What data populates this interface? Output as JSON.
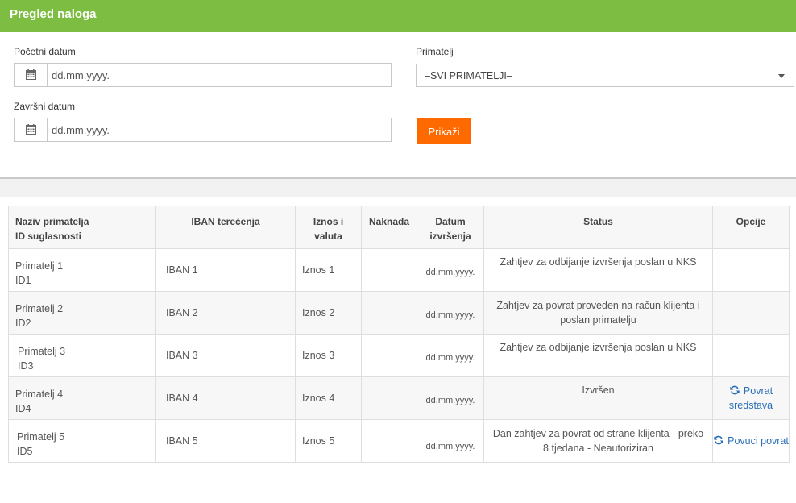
{
  "header": {
    "title": "Pregled naloga"
  },
  "filters": {
    "start_date_label": "Početni datum",
    "start_date_placeholder": "dd.mm.yyyy.",
    "end_date_label": "Završni datum",
    "end_date_placeholder": "dd.mm.yyyy.",
    "recipient_label": "Primatelj",
    "recipient_value": "–SVI PRIMATELJI–",
    "show_button": "Prikaži"
  },
  "colors": {
    "header": "#7cbd42",
    "button": "#ff6a00",
    "link": "#2a6fb7"
  },
  "table": {
    "headers": {
      "name_line1": "Naziv primatelja",
      "name_line2": "ID suglasnosti",
      "iban": "IBAN terećenja",
      "amount_line1": "Iznos i",
      "amount_line2": "valuta",
      "fee": "Naknada",
      "date_line1": "Datum",
      "date_line2": "izvršenja",
      "status": "Status",
      "options": "Opcije"
    },
    "rows": [
      {
        "name": "Primatelj 1",
        "id": "ID1",
        "iban": "IBAN 1",
        "amount": "Iznos 1",
        "fee": "",
        "date": "dd.mm.yyyy.",
        "status": "Zahtjev za odbijanje izvršenja poslan u NKS",
        "option": ""
      },
      {
        "name": "Primatelj 2",
        "id": "ID2",
        "iban": "IBAN 2",
        "amount": "Iznos 2",
        "fee": "",
        "date": "dd.mm.yyyy.",
        "status": "Zahtjev za povrat proveden na račun klijenta i poslan primatelju",
        "option": ""
      },
      {
        "name": "Primatelj 3",
        "id": "ID3",
        "iban": "IBAN 3",
        "amount": "Iznos 3",
        "fee": "",
        "date": "dd.mm.yyyy.",
        "status": "Zahtjev za odbijanje izvršenja poslan u NKS",
        "option": ""
      },
      {
        "name": "Primatelj 4",
        "id": "ID4",
        "iban": "IBAN 4",
        "amount": "Iznos 4",
        "fee": "",
        "date": "dd.mm.yyyy.",
        "status": "Izvršen",
        "option": "Povrat sredstava",
        "option_icon": "refresh-icon"
      },
      {
        "name": "Primatelj 5",
        "id": "ID5",
        "iban": "IBAN 5",
        "amount": "Iznos 5",
        "fee": "",
        "date": "dd.mm.yyyy.",
        "status": "Dan zahtjev za povrat od strane klijenta - preko 8 tjedana - Neautoriziran",
        "option": "Povuci povrat",
        "option_icon": "refresh-icon"
      }
    ]
  }
}
